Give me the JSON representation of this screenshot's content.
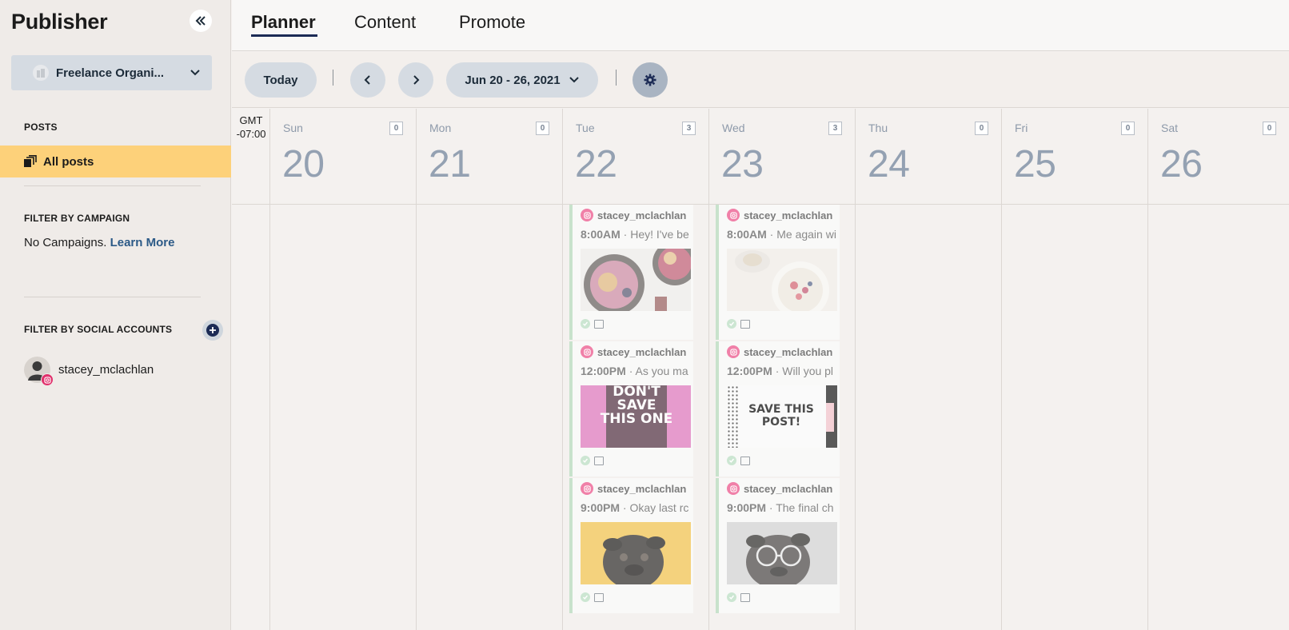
{
  "sidebar": {
    "app_title": "Publisher",
    "organization": "Freelance Organi...",
    "posts_heading": "POSTS",
    "all_posts": "All posts",
    "campaign_heading": "FILTER BY CAMPAIGN",
    "no_campaigns": "No Campaigns.",
    "learn_more": "Learn More",
    "social_heading": "FILTER BY SOCIAL ACCOUNTS",
    "account": "stacey_mclachlan"
  },
  "tabs": [
    {
      "label": "Planner",
      "active": true
    },
    {
      "label": "Content",
      "active": false
    },
    {
      "label": "Promote",
      "active": false
    }
  ],
  "toolbar": {
    "today": "Today",
    "date_range": "Jun 20 - 26, 2021"
  },
  "calendar": {
    "gmt_line1": "GMT",
    "gmt_line2": "-07:00",
    "days": [
      {
        "name": "Sun",
        "num": "20",
        "count": "0"
      },
      {
        "name": "Mon",
        "num": "21",
        "count": "0"
      },
      {
        "name": "Tue",
        "num": "22",
        "count": "3"
      },
      {
        "name": "Wed",
        "num": "23",
        "count": "3"
      },
      {
        "name": "Thu",
        "num": "24",
        "count": "0"
      },
      {
        "name": "Fri",
        "num": "25",
        "count": "0"
      },
      {
        "name": "Sat",
        "num": "26",
        "count": "0"
      }
    ],
    "posts": {
      "tue": [
        {
          "account": "stacey_mclachlan",
          "time": "8:00AM",
          "text": " · Hey! I've be",
          "image": "smoothie-bowls"
        },
        {
          "account": "stacey_mclachlan",
          "time": "12:00PM",
          "text": " · As you ma",
          "image_text": "DON'T SAVE THIS ONE"
        },
        {
          "account": "stacey_mclachlan",
          "time": "9:00PM",
          "text": " · Okay last rc",
          "image": "pug-yellow"
        }
      ],
      "wed": [
        {
          "account": "stacey_mclachlan",
          "time": "8:00AM",
          "text": " · Me again wi",
          "image": "yogurt-bowl"
        },
        {
          "account": "stacey_mclachlan",
          "time": "12:00PM",
          "text": " · Will you pl",
          "image_text": "SAVE THIS POST!"
        },
        {
          "account": "stacey_mclachlan",
          "time": "9:00PM",
          "text": " · The final ch",
          "image": "pug-glasses"
        }
      ]
    }
  },
  "colors": {
    "accent": "#fdd17a",
    "pill": "#d5dbe2",
    "instagram": "#e1306c",
    "link": "#2c5a87"
  }
}
